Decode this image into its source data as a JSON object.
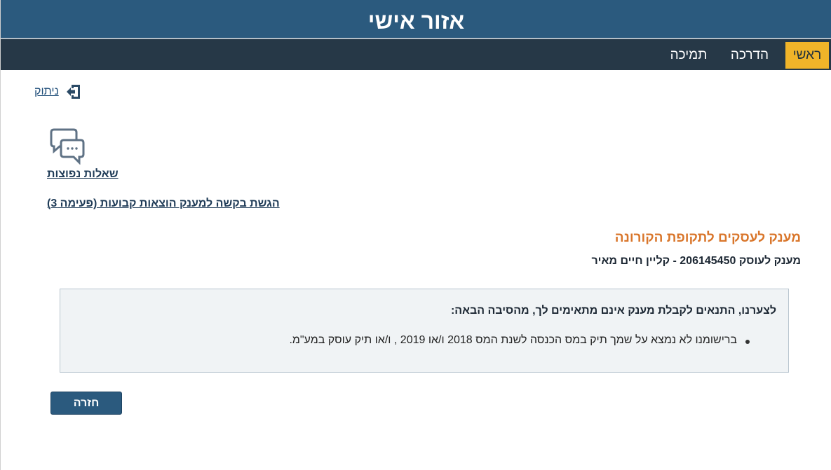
{
  "header": {
    "title": "אזור אישי"
  },
  "nav": {
    "home": "ראשי",
    "guide": "הדרכה",
    "support": "תמיכה"
  },
  "logout": {
    "label": "ניתוק"
  },
  "links": {
    "faq": "שאלות נפוצות",
    "request": "הגשת בקשה למענק הוצאות קבועות (פעימה 3)"
  },
  "main": {
    "section_title": "מענק לעסקים לתקופת הקורונה",
    "grant_line": "מענק לעוסק 206145450 - קליין חיים מאיר"
  },
  "notice": {
    "heading": "לצערנו, התנאים לקבלת מענק אינם מתאימים לך, מהסיבה הבאה:",
    "reasons": [
      "ברישומנו לא נמצא על שמך תיק במס הכנסה לשנת המס 2018 ו/או 2019 , ו/או תיק עוסק במע\"מ."
    ]
  },
  "buttons": {
    "back": "חזרה"
  },
  "colors": {
    "header_bg": "#2b5a7e",
    "nav_bg": "#263847",
    "active_tab": "#f0b429",
    "section_title": "#d9762b",
    "notice_bg": "#f0f3f5",
    "button_bg": "#2b5a7e"
  },
  "icons": {
    "logout": "logout-icon",
    "faq": "chat-bubbles-icon",
    "emblem": "emblem-icon"
  }
}
